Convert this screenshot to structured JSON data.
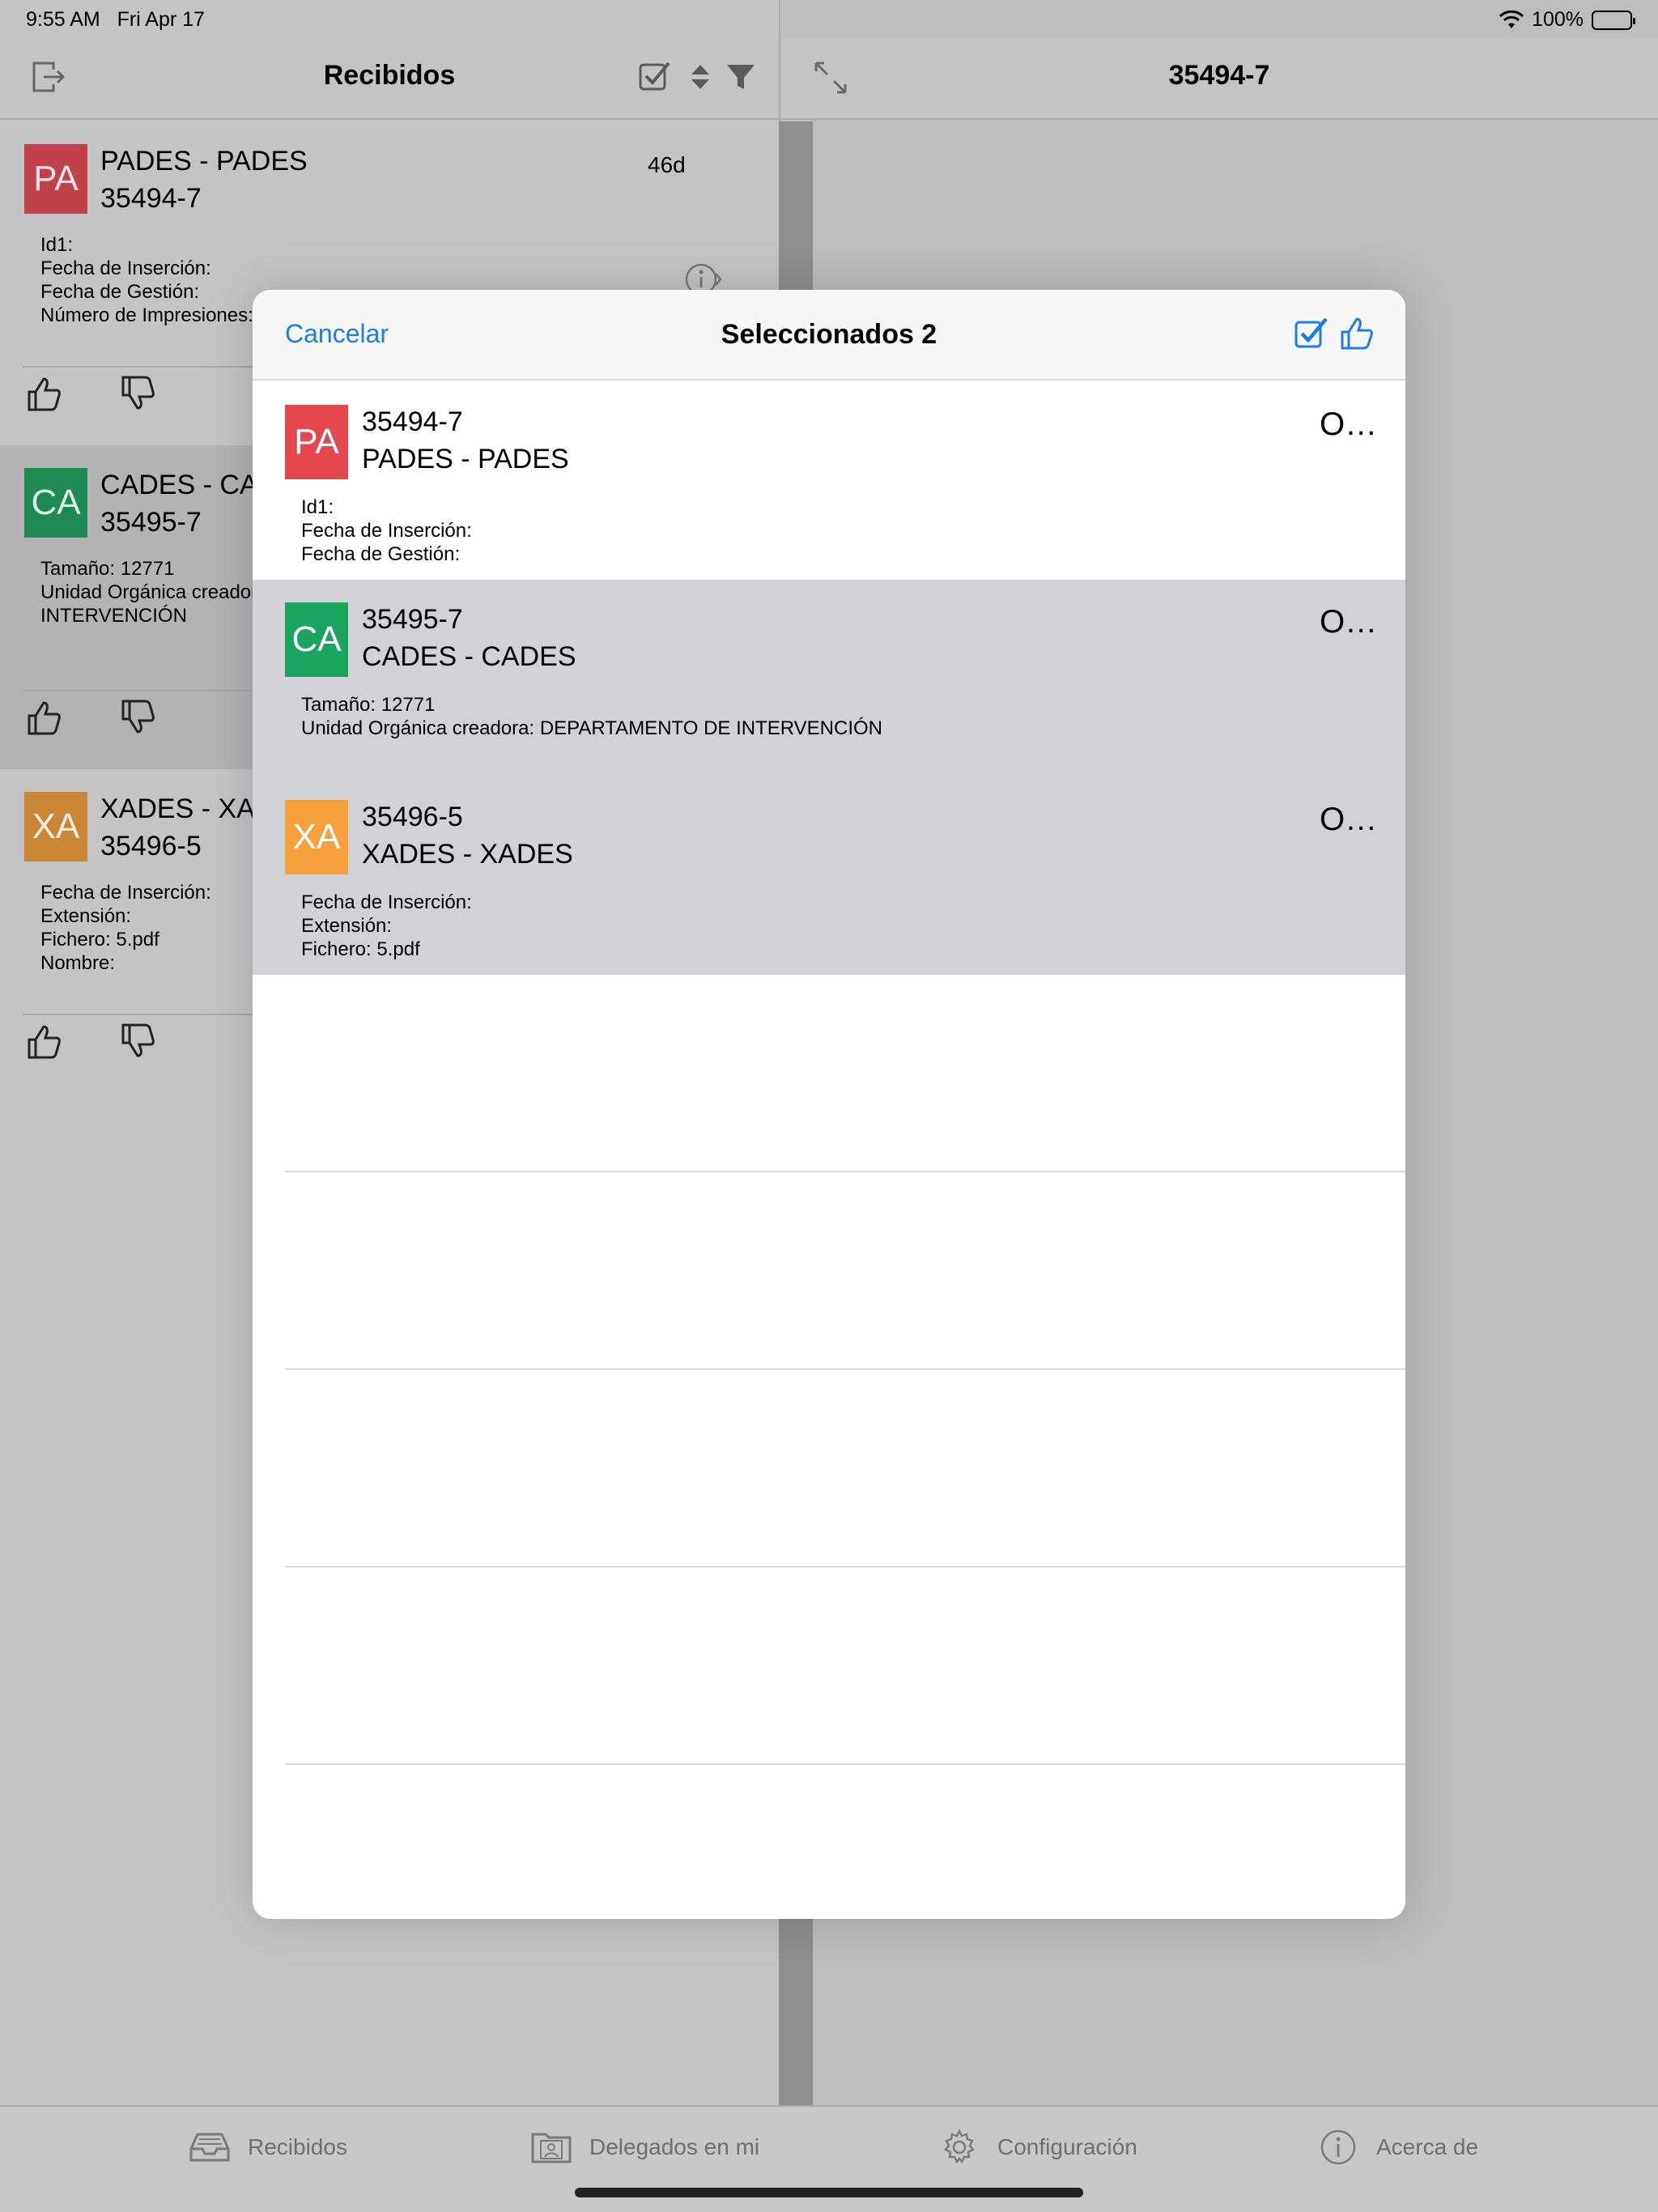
{
  "status_bar": {
    "time": "9:55 AM",
    "date": "Fri Apr 17",
    "battery": "100%"
  },
  "left_panel": {
    "title": "Recibidos",
    "items": [
      {
        "initials": "PA",
        "color": "#c0414a",
        "line1": "PADES - PADES",
        "line2": "35494-7",
        "age": "46d",
        "meta": [
          "Id1:",
          "Fecha de Inserción:",
          "Fecha de Gestión:",
          "Número de Impresiones:"
        ]
      },
      {
        "initials": "CA",
        "color": "#1c8a52",
        "line1": "CADES - CADES",
        "line2": "35495-7",
        "age": "",
        "meta": [
          "Tamaño:  12771",
          "Unidad Orgánica creadora:",
          "INTERVENCIÓN"
        ]
      },
      {
        "initials": "XA",
        "color": "#c98634",
        "line1": "XADES - XADES",
        "line2": "35496-5",
        "age": "",
        "meta": [
          "Fecha de Inserción:",
          "Extensión:",
          "Fichero:  5.pdf",
          "Nombre:"
        ]
      }
    ]
  },
  "detail_panel": {
    "title": "35494-7"
  },
  "modal": {
    "cancel_label": "Cancelar",
    "title": "Seleccionados 2",
    "rows": [
      {
        "initials": "PA",
        "color": "#e5474f",
        "line1": "35494-7",
        "line2": "PADES - PADES",
        "trailing": "O…",
        "selected": false,
        "meta": [
          "Id1:",
          "Fecha de Inserción:",
          "Fecha de Gestión:"
        ]
      },
      {
        "initials": "CA",
        "color": "#19a55f",
        "line1": "35495-7",
        "line2": "CADES - CADES",
        "trailing": "O…",
        "selected": true,
        "meta": [
          "Tamaño:  12771",
          "Unidad Orgánica creadora:  DEPARTAMENTO DE INTERVENCIÓN"
        ]
      },
      {
        "initials": "XA",
        "color": "#f6a03c",
        "line1": "35496-5",
        "line2": "XADES - XADES",
        "trailing": "O…",
        "selected": true,
        "meta": [
          "Fecha de Inserción:",
          "Extensión:",
          "Fichero:  5.pdf"
        ]
      }
    ]
  },
  "tab_bar": {
    "tabs": [
      {
        "label": "Recibidos",
        "icon": "inbox-icon"
      },
      {
        "label": "Delegados en mi",
        "icon": "delegates-folder-icon"
      },
      {
        "label": "Configuración",
        "icon": "gear-icon"
      },
      {
        "label": "Acerca de",
        "icon": "info-icon"
      }
    ]
  },
  "colors": {
    "accent": "#1e7ce6",
    "selected_row": "#d2d2d6"
  }
}
